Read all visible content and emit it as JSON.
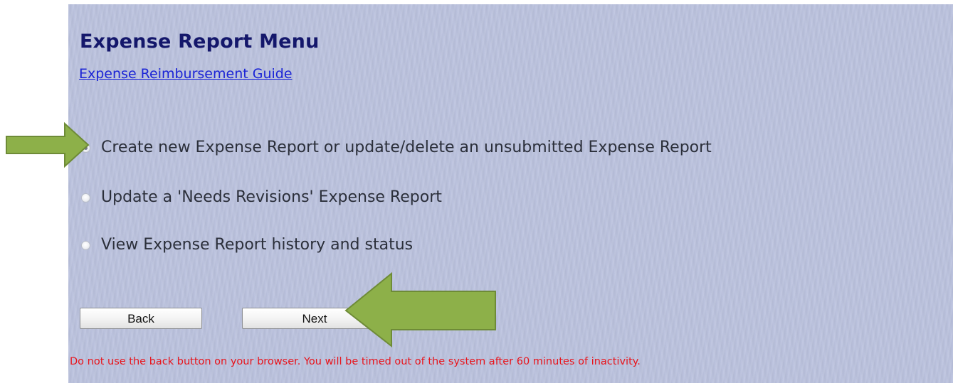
{
  "page": {
    "title": "Expense Report Menu",
    "guide_link": "Expense Reimbursement Guide"
  },
  "options": [
    {
      "label": "Create new Expense Report or update/delete an unsubmitted Expense Report",
      "selected": true
    },
    {
      "label": "Update a 'Needs Revisions' Expense Report",
      "selected": false
    },
    {
      "label": "View Expense Report history and status",
      "selected": false
    }
  ],
  "buttons": {
    "back_label": "Back",
    "next_label": "Next"
  },
  "warning_text": "Do not use the back button on your browser. You will be timed out of the system after 60 minutes of inactivity.",
  "colors": {
    "panel_background": "#bcc3df",
    "title": "#14176b",
    "link": "#1b24d6",
    "warning": "#e8141b",
    "arrow_fill": "#8db049",
    "arrow_stroke": "#6e8b37"
  }
}
